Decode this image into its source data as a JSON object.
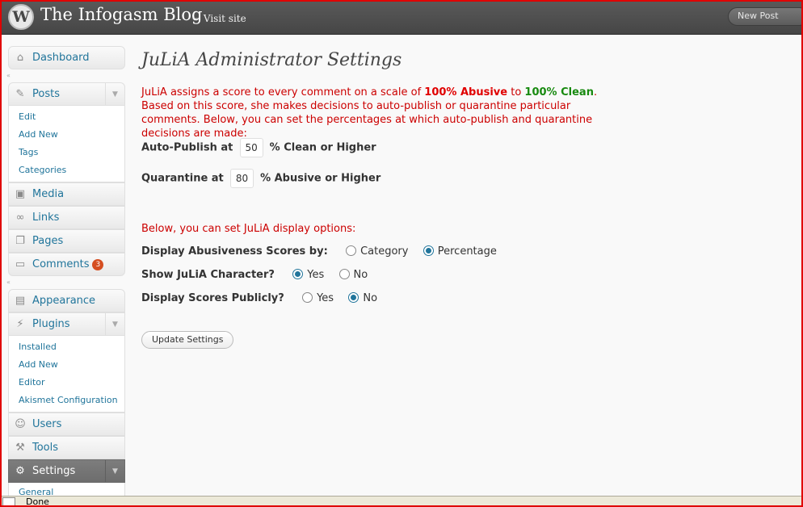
{
  "header": {
    "logo": "W",
    "site_title": "The Infogasm Blog",
    "visit_site": "← Visit site",
    "new_post": "New Post"
  },
  "sidebar": {
    "dashboard": "Dashboard",
    "posts": {
      "label": "Posts",
      "items": [
        "Edit",
        "Add New",
        "Tags",
        "Categories"
      ]
    },
    "media": "Media",
    "links": "Links",
    "pages": "Pages",
    "comments": "Comments",
    "comments_count": "3",
    "appearance": "Appearance",
    "plugins": {
      "label": "Plugins",
      "items": [
        "Installed",
        "Add New",
        "Editor",
        "Akismet Configuration"
      ]
    },
    "users": "Users",
    "tools": "Tools",
    "settings": {
      "label": "Settings",
      "items": [
        "General"
      ]
    },
    "separator_glyph": "«",
    "toggle_glyph": "▼"
  },
  "main": {
    "title": "JuLiA Administrator Settings",
    "intro_1": "JuLiA assigns a score to every comment on a scale of ",
    "intro_abusive": "100% Abusive",
    "intro_to": " to ",
    "intro_clean": "100% Clean",
    "intro_2": ". Based on this score, she makes decisions to auto-publish or quarantine particular comments. Below, you can set the percentages at which auto-publish and quarantine decisions are made:",
    "autopublish": {
      "label": "Auto-Publish at",
      "value": "50",
      "suffix": "% Clean or Higher"
    },
    "quarantine": {
      "label": "Quarantine at",
      "value": "80",
      "suffix": "% Abusive or Higher"
    },
    "display_note": "Below, you can set JuLiA display options:",
    "display_scores_by": {
      "label": "Display Abusiveness Scores by:",
      "option_1": "Category",
      "option_2": "Percentage",
      "selected": "Percentage"
    },
    "show_character": {
      "label": "Show JuLiA Character?",
      "option_yes": "Yes",
      "option_no": "No",
      "selected": "Yes"
    },
    "display_publicly": {
      "label": "Display Scores Publicly?",
      "option_yes": "Yes",
      "option_no": "No",
      "selected": "No"
    },
    "update_button": "Update Settings"
  },
  "statusbar": {
    "text": "Done"
  },
  "colors": {
    "link": "#21759b",
    "intro_red": "#cc0000",
    "abusive_red": "#e00000",
    "clean_green": "#188a10",
    "header_bg": "#464646",
    "badge": "#d54e21"
  }
}
